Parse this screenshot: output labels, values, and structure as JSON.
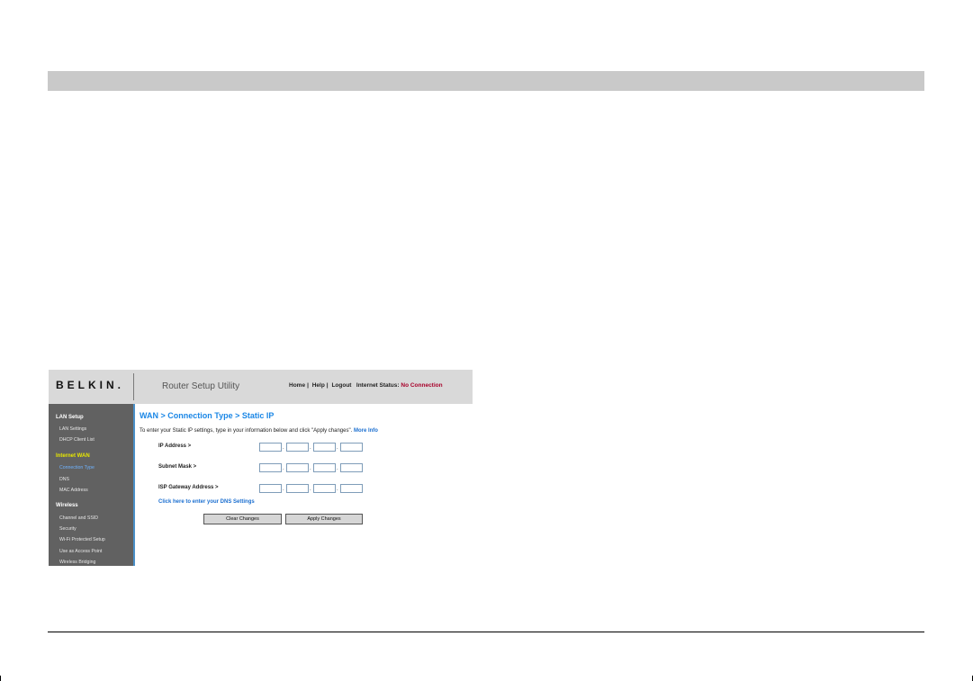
{
  "router": {
    "logo": "BELKIN.",
    "app_title": "Router Setup Utility",
    "nav": {
      "home": "Home",
      "help": "Help",
      "logout": "Logout",
      "status_label": "Internet Status:",
      "status_value": "No Connection"
    },
    "sidebar": {
      "lan": {
        "header": "LAN Setup",
        "items": [
          "LAN Settings",
          "DHCP Client List"
        ]
      },
      "wan": {
        "header": "Internet WAN",
        "items": [
          "Connection Type",
          "DNS",
          "MAC Address"
        ]
      },
      "wireless": {
        "header": "Wireless",
        "items": [
          "Channel and SSID",
          "Security",
          "Wi-Fi Protected Setup",
          "Use as Access Point",
          "Wireless Bridging"
        ]
      }
    },
    "main": {
      "title": "WAN > Connection Type > Static IP",
      "intro": "To enter your Static IP settings, type in your information below and click \"Apply changes\".",
      "more_info": "More Info",
      "fields": {
        "ip": "IP Address >",
        "subnet": "Subnet Mask >",
        "gateway": "ISP Gateway Address >"
      },
      "dns_link": "Click here to enter your DNS Settings",
      "clear_button": "Clear Changes",
      "apply_button": "Apply Changes"
    }
  }
}
